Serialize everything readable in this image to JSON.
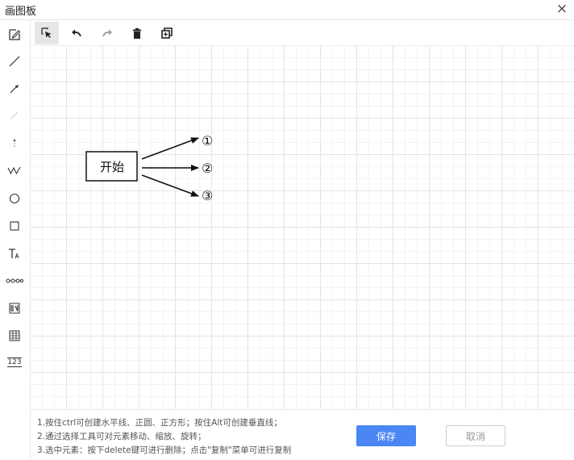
{
  "window": {
    "title": "画图板",
    "close_symbol": "×"
  },
  "left_toolbar": {
    "tools": [
      {
        "name": "pencil-icon"
      },
      {
        "name": "line-icon"
      },
      {
        "name": "arrow-icon"
      },
      {
        "name": "dashed-line-icon"
      },
      {
        "name": "dashed-arrow-icon"
      },
      {
        "name": "polyline-icon"
      },
      {
        "name": "circle-icon"
      },
      {
        "name": "square-icon"
      },
      {
        "name": "text-icon"
      },
      {
        "name": "node-chain-icon"
      },
      {
        "name": "number-line-icon"
      },
      {
        "name": "grid-table-icon"
      },
      {
        "name": "number-123-icon",
        "label": "123"
      }
    ]
  },
  "top_toolbar": {
    "tools": [
      {
        "name": "select-icon",
        "active": true
      },
      {
        "name": "undo-icon"
      },
      {
        "name": "redo-icon",
        "disabled": true
      },
      {
        "name": "delete-icon"
      },
      {
        "name": "copy-icon"
      }
    ]
  },
  "canvas": {
    "box_label": "开始",
    "labels": [
      "①",
      "②",
      "③"
    ]
  },
  "bottom": {
    "tips": [
      "1.按住ctrl可创建水平线、正圆、正方形；按住Alt可创建垂直线；",
      "2.通过选择工具可对元素移动、缩放、旋转；",
      "3.选中元素：按下delete键可进行删除；点击\"复制\"菜单可进行复制"
    ],
    "save_label": "保存",
    "cancel_label": "取消"
  },
  "colors": {
    "accent": "#4a86f4",
    "grid_major": "#e4e4e4",
    "grid_minor": "#f3f3f3"
  }
}
